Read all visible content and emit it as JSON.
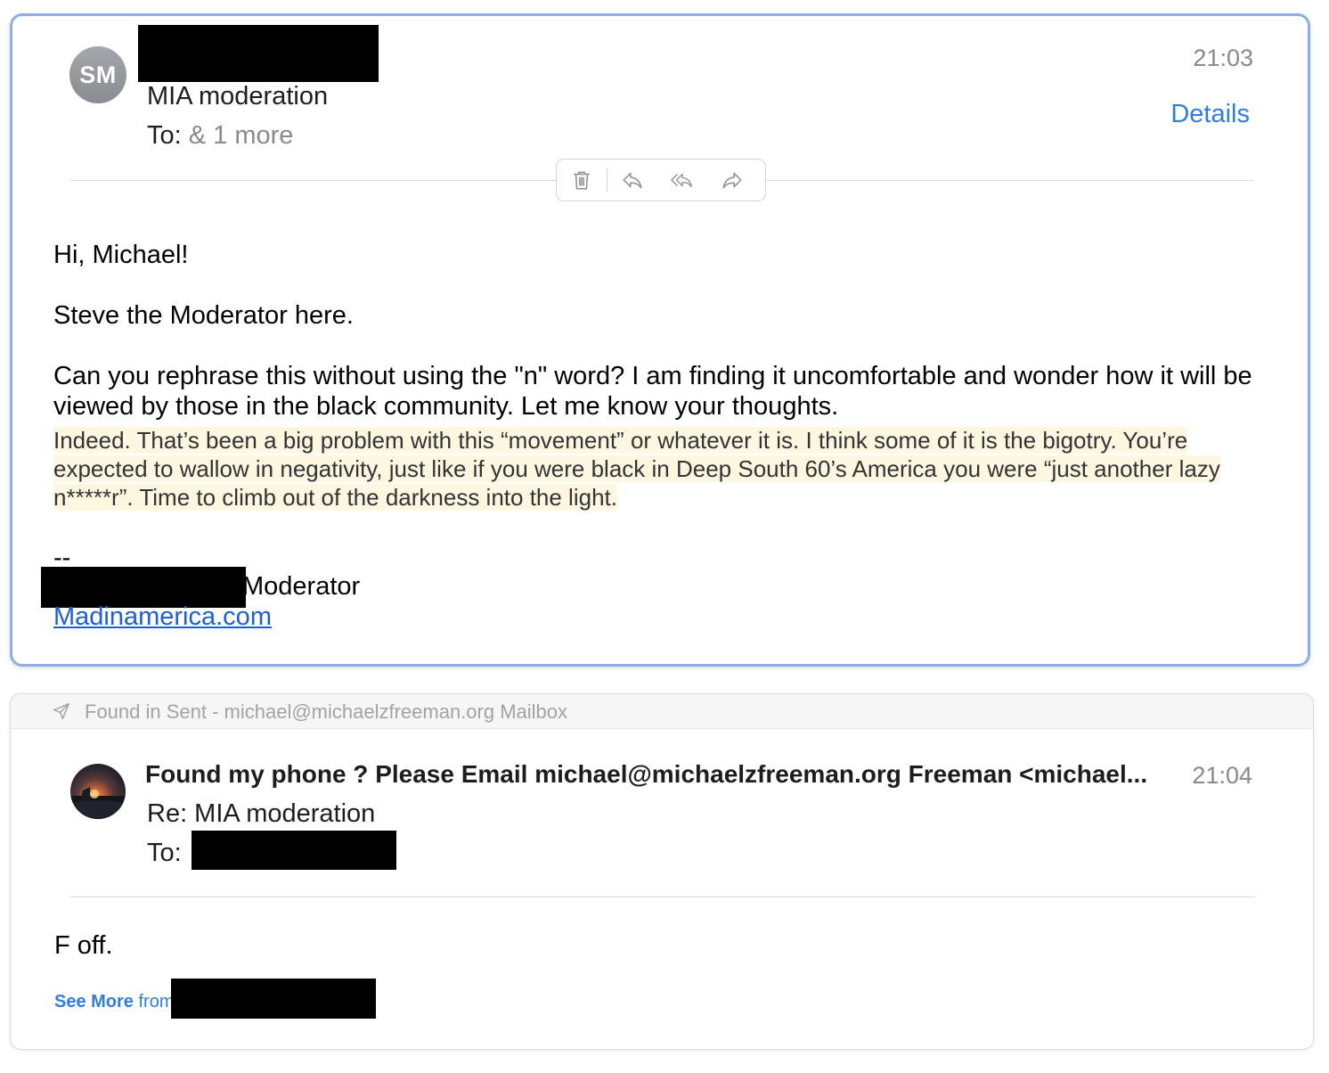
{
  "message1": {
    "avatar_initials": "SM",
    "subject": "MIA moderation",
    "to_label": "To:",
    "to_more": "& 1 more",
    "time": "21:03",
    "details_label": "Details",
    "toolbar": {
      "delete_icon": "trash-icon",
      "reply_icon": "reply-icon",
      "reply_all_icon": "reply-all-icon",
      "forward_icon": "forward-icon"
    },
    "body": {
      "greeting": "Hi, Michael!",
      "intro": "Steve the Moderator here.",
      "main": "Can you rephrase this without using the \"n\" word? I am finding it uncomfortable and wonder how it will be viewed by those in the black community. Let me know your thoughts.",
      "quote": "Indeed. That’s been a big problem with this “movement” or whatever it is. I think some of it is the bigotry. You’re expected to wallow in negativity, just like if you were black in Deep South 60’s America you were “just another lazy n*****r”. Time to climb out of the darkness into the light.",
      "sig_dash": "--",
      "sig_role": "Moderator",
      "sig_link": "Madinamerica.com"
    }
  },
  "message2": {
    "found_in": "Found in Sent - michael@michaelzfreeman.org Mailbox",
    "sender": "Found my phone ? Please Email michael@michaelzfreeman.org Freeman <michael...",
    "time": "21:04",
    "subject": "Re: MIA moderation",
    "to_label": "To:",
    "body": "F off.",
    "see_more_bold": "See More",
    "see_more_rest": " from"
  },
  "colors": {
    "accent": "#2f7de1",
    "selected_border": "#8eaee6",
    "quote_highlight": "#fdf7e2",
    "redaction": "#000000"
  }
}
